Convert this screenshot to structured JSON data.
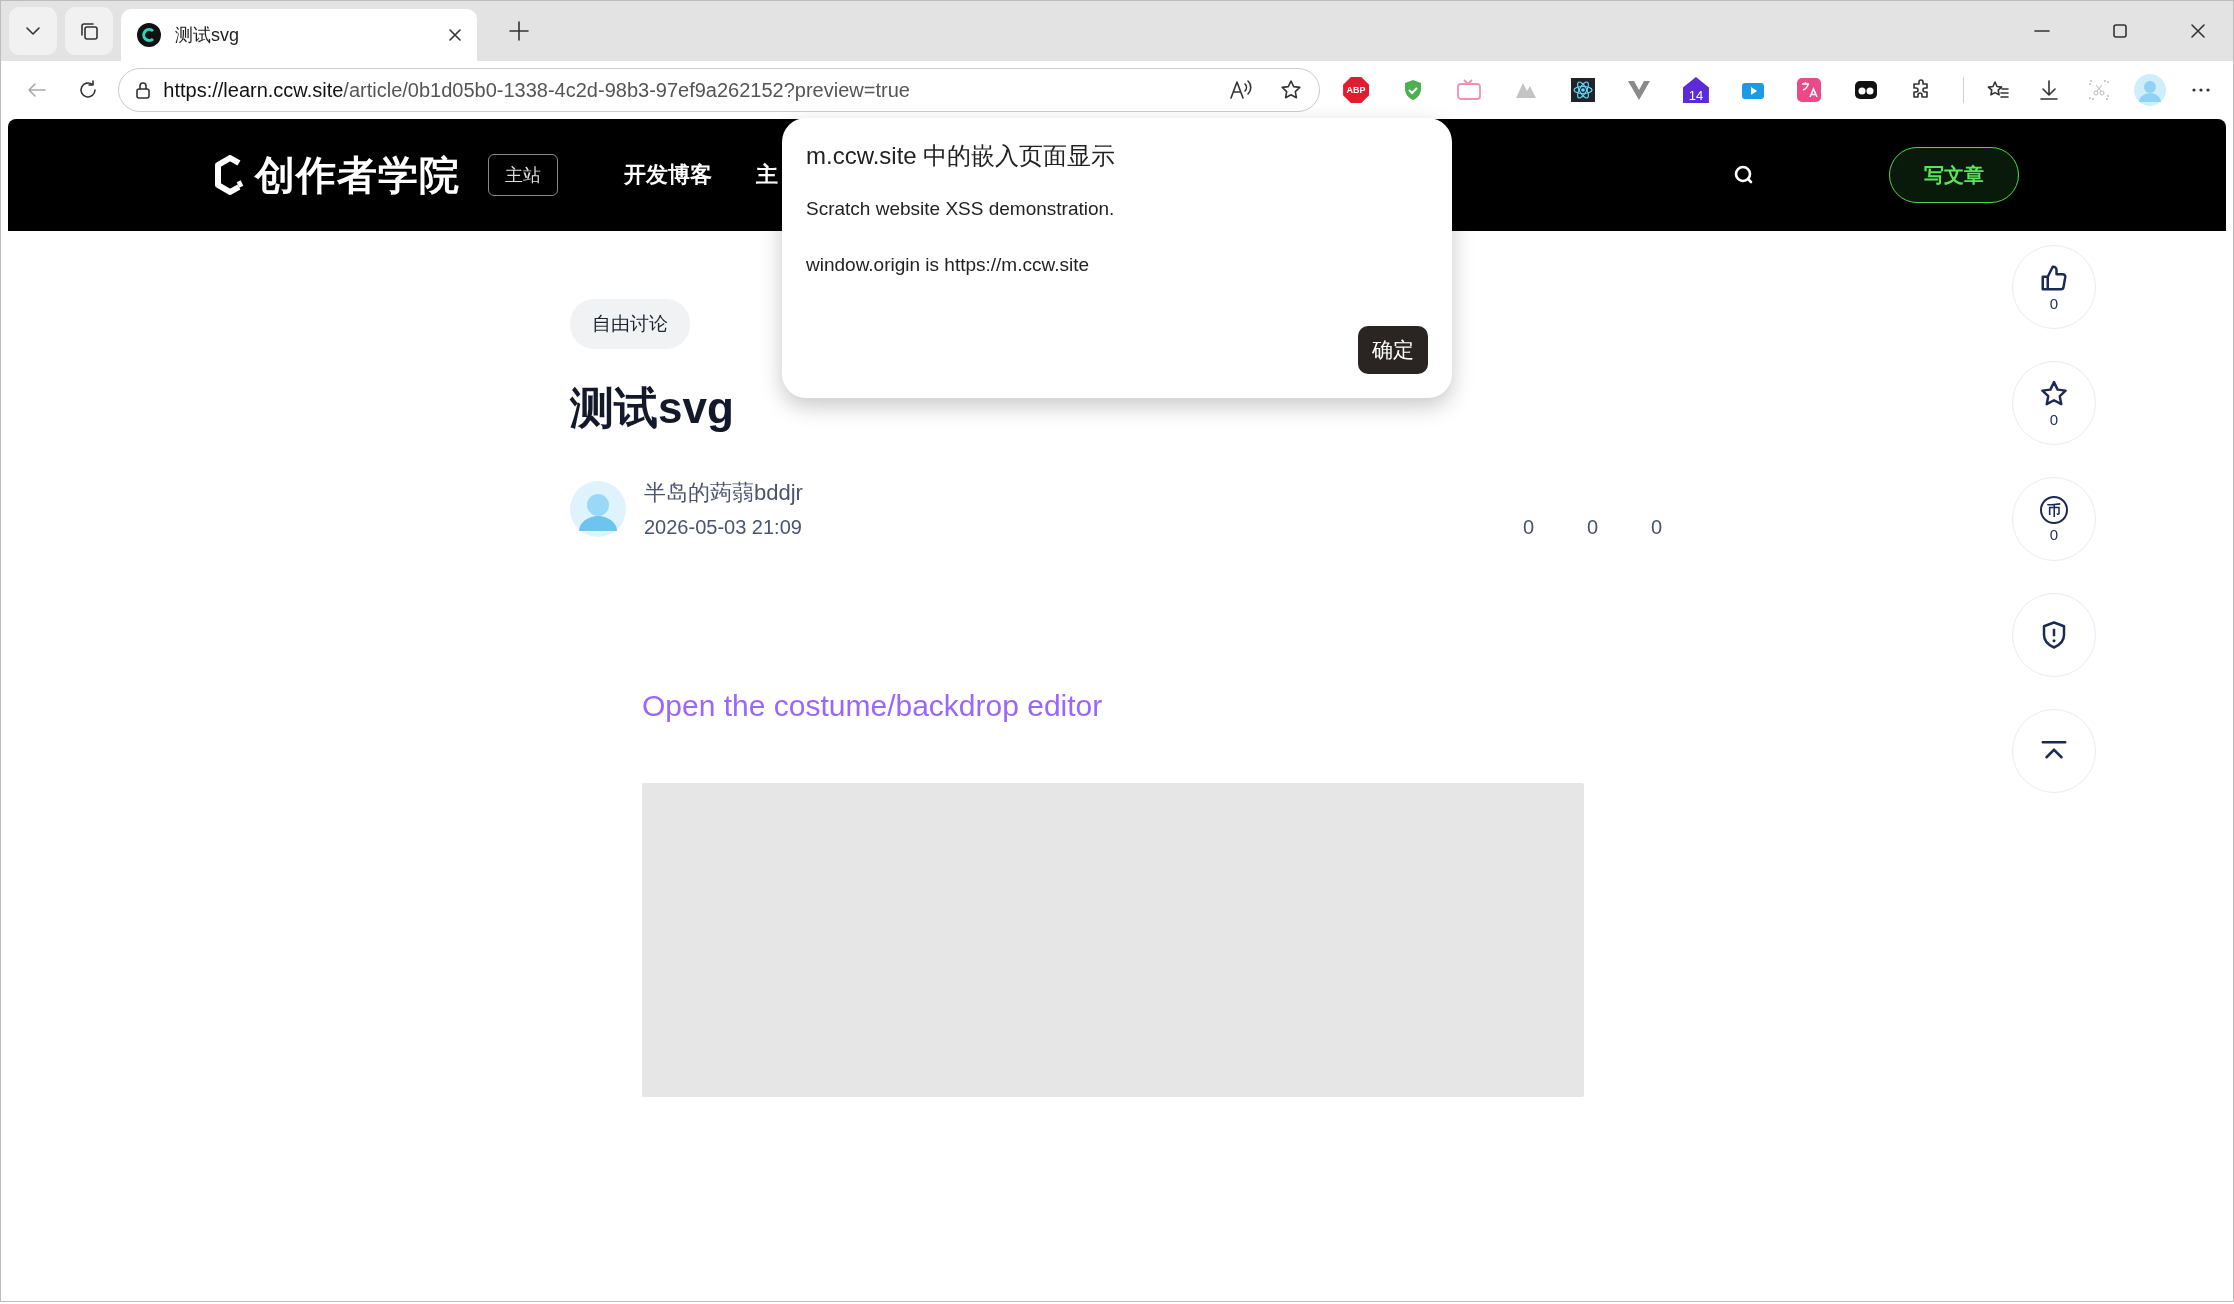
{
  "browser": {
    "tabs": [
      {
        "title": "测试svg",
        "selected": true
      }
    ],
    "address_bar": {
      "url_host": "https://learn.ccw.site",
      "url_path": "/article/0b1d05b0-1338-4c2d-98b3-97ef9a262152?preview=true"
    },
    "extensions": [
      {
        "kind": "abp",
        "badge": "ABP"
      },
      {
        "kind": "shield"
      },
      {
        "kind": "tv-pink"
      },
      {
        "kind": "mountain"
      },
      {
        "kind": "atom"
      },
      {
        "kind": "vue"
      },
      {
        "kind": "house",
        "badge": "14"
      },
      {
        "kind": "tv-blue"
      },
      {
        "kind": "translate"
      },
      {
        "kind": "dots"
      },
      {
        "kind": "puzzle"
      }
    ]
  },
  "site_header": {
    "logo": "创作者学院",
    "badge": "主站",
    "nav": [
      {
        "label": "开发博客"
      },
      {
        "label": "主"
      }
    ],
    "write_button": "写文章"
  },
  "dialog": {
    "title": "m.ccw.site 中的嵌入页面显示",
    "messages": [
      "Scratch website XSS demonstration.",
      "window.origin is https://m.ccw.site"
    ],
    "ok_button": "确定"
  },
  "article": {
    "tag": "自由讨论",
    "title": "测试svg",
    "author": "半岛的蒟蒻bddjr",
    "date": "2026-05-03 21:09",
    "stats": [
      "0",
      "0",
      "0"
    ],
    "link": "Open the costume/backdrop editor",
    "embed": {
      "kind": "blank"
    }
  },
  "side_actions": [
    {
      "kind": "like",
      "count": "0"
    },
    {
      "kind": "star",
      "count": "0"
    },
    {
      "kind": "coin",
      "glyph": "币",
      "count": "0"
    },
    {
      "kind": "report"
    },
    {
      "kind": "top"
    }
  ]
}
